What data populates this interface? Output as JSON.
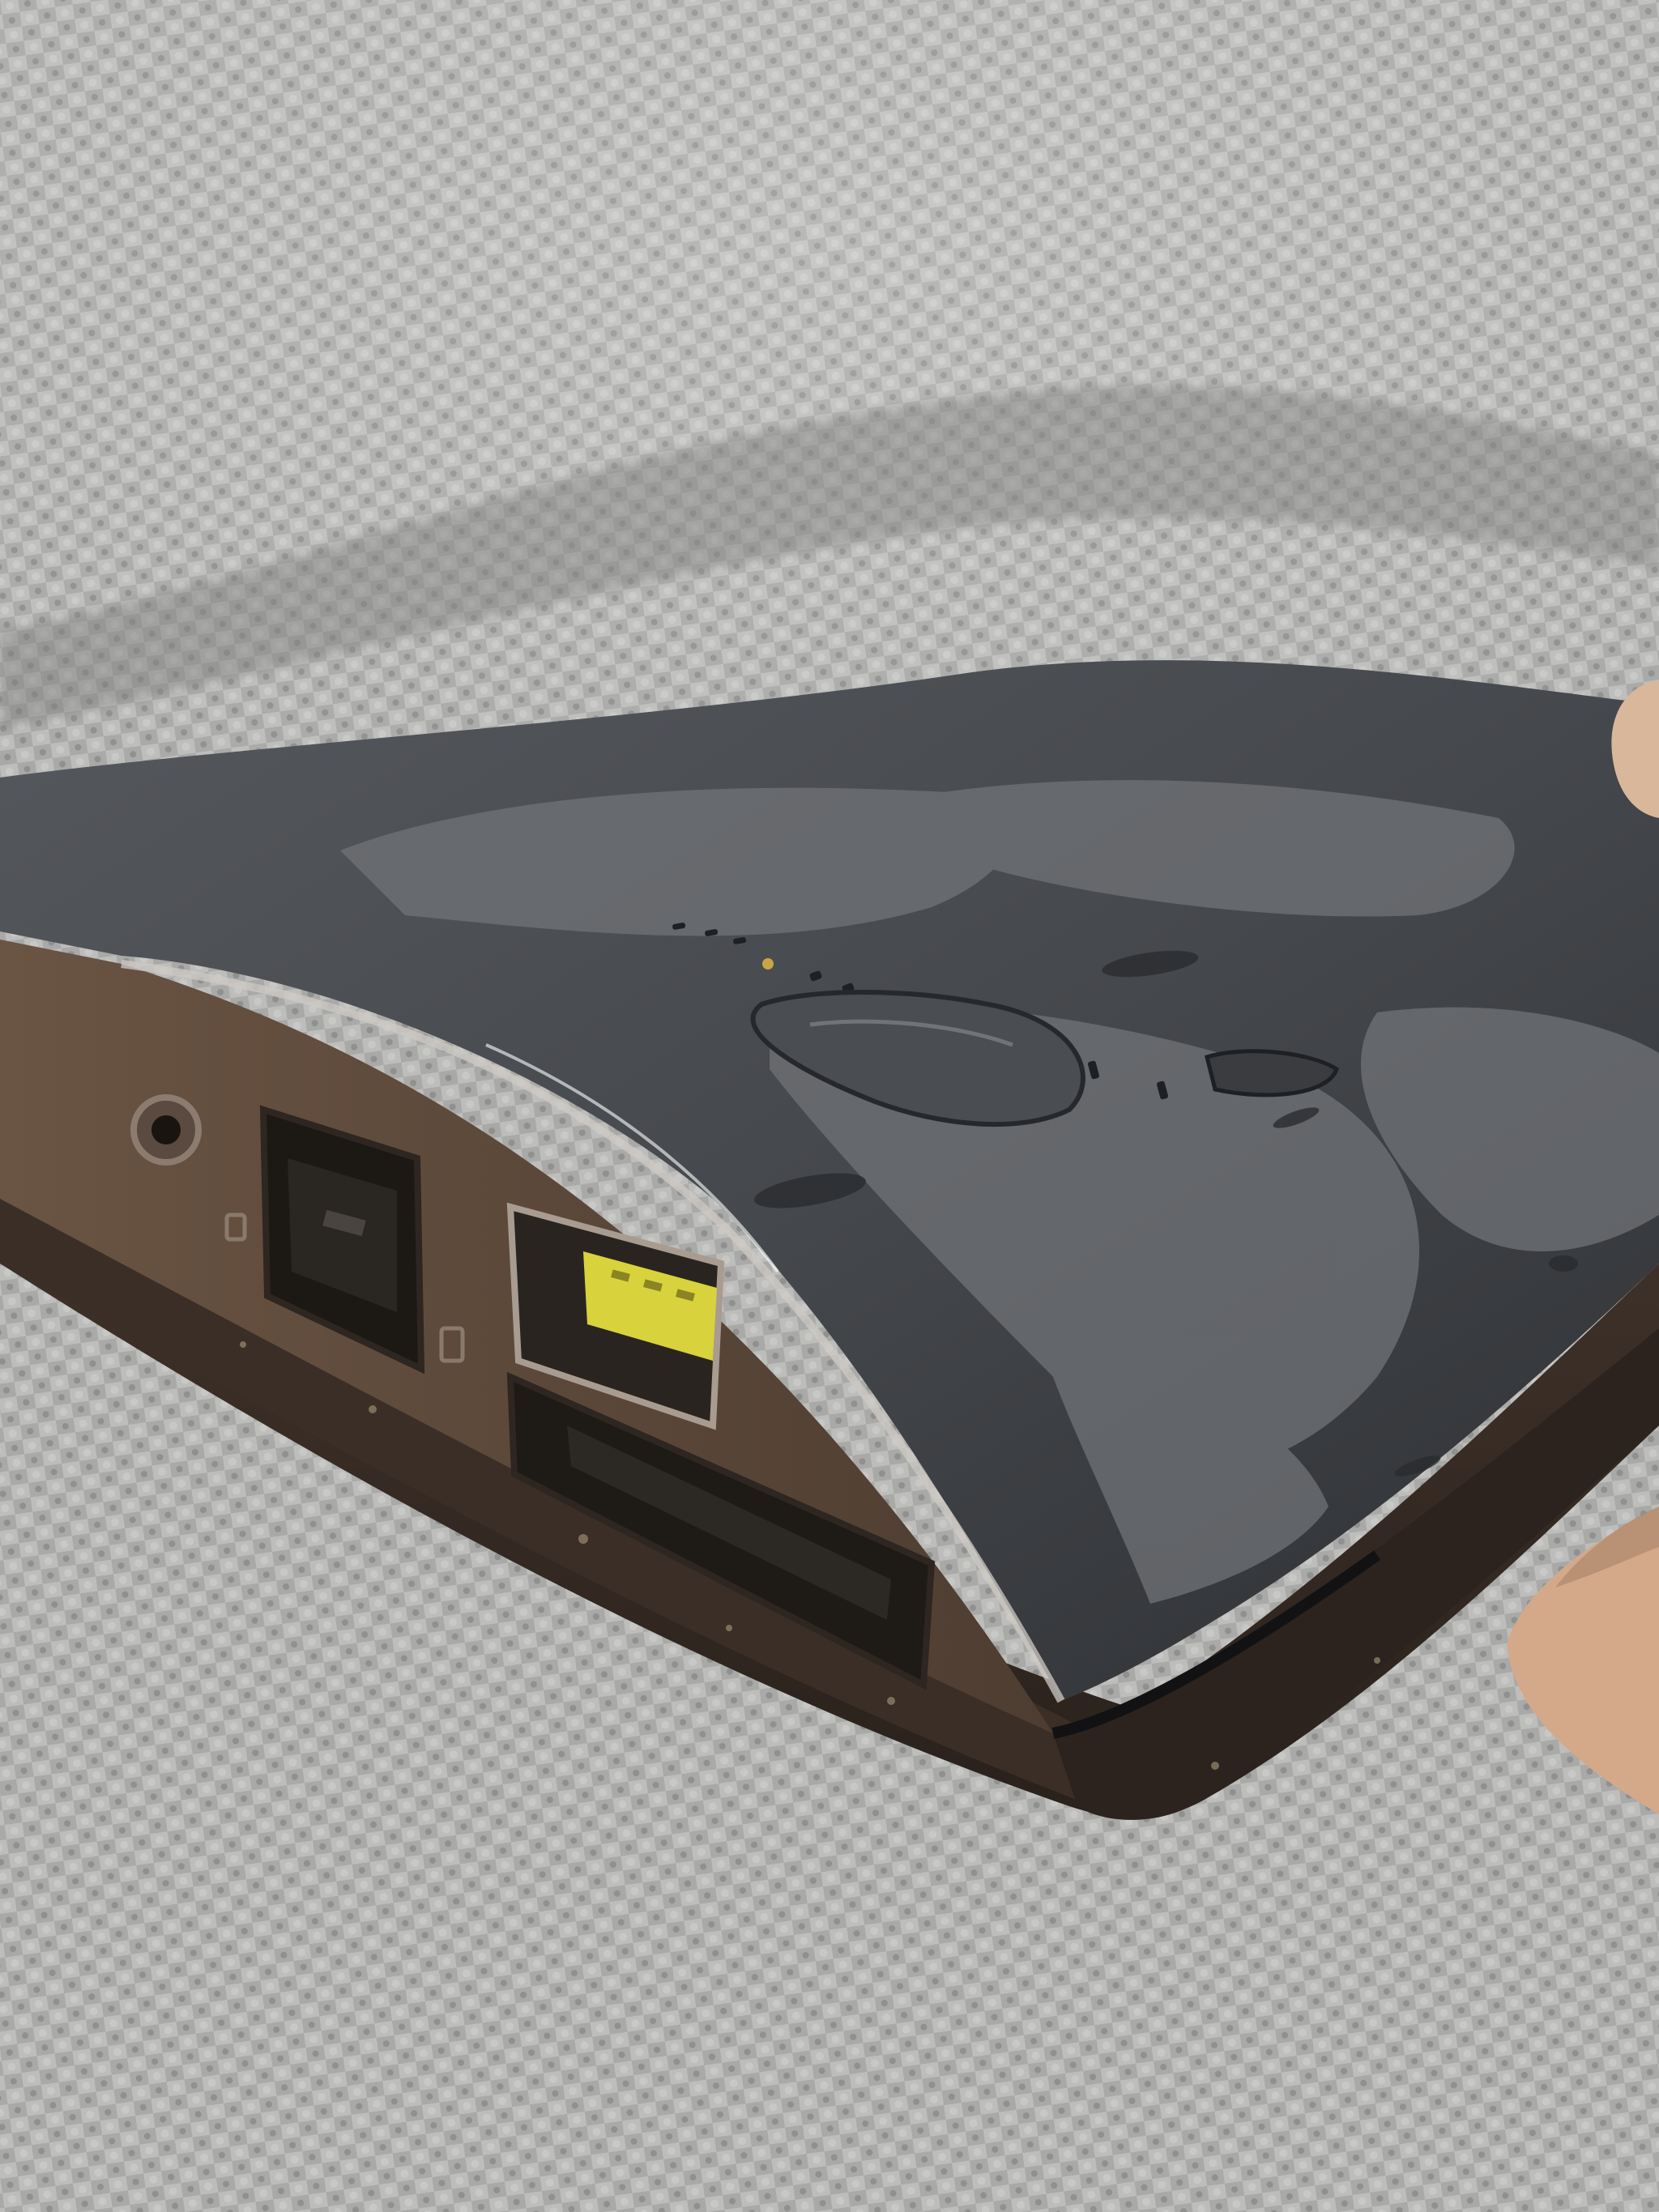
{
  "photo": {
    "subject": "laptop-corner-closeup",
    "colors": {
      "carpet_light": "#b4b4b2",
      "carpet_dark": "#8a8a88",
      "lid_dark": "#3e4044",
      "lid_worn": "#6d7074",
      "chassis": "#3a2f2a",
      "port_bezel": "#5a4638",
      "usb_insert": "#d8d23c",
      "skin": "#d9b79a"
    },
    "icons": [
      "audio-jack-icon",
      "ethernet-port-icon",
      "usb-port-icon",
      "card-slot-icon"
    ]
  }
}
